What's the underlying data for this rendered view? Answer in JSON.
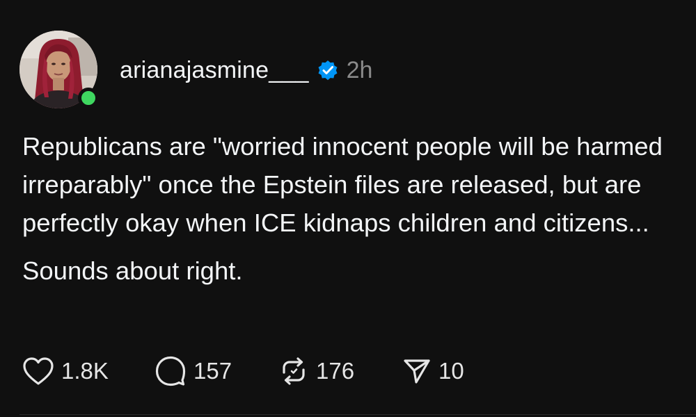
{
  "post": {
    "username": "arianajasmine___",
    "timestamp": "2h",
    "text_paragraph_1": "Republicans are \"worried innocent people will be harmed irreparably\" once the Epstein files are released, but are perfectly okay when ICE kidnaps children and citizens...",
    "text_paragraph_2": "Sounds about right.",
    "likes": "1.8K",
    "replies": "157",
    "reposts": "176",
    "shares": "10"
  },
  "icons": {
    "verified": "verified-badge-icon",
    "like": "heart-icon",
    "reply": "speech-bubble-icon",
    "repost": "repost-icon",
    "share": "paper-plane-icon"
  },
  "colors": {
    "background": "#101010",
    "text": "#f3f5f7",
    "muted": "#8a8a8a",
    "verified": "#0095f6",
    "online": "#3fd760"
  }
}
